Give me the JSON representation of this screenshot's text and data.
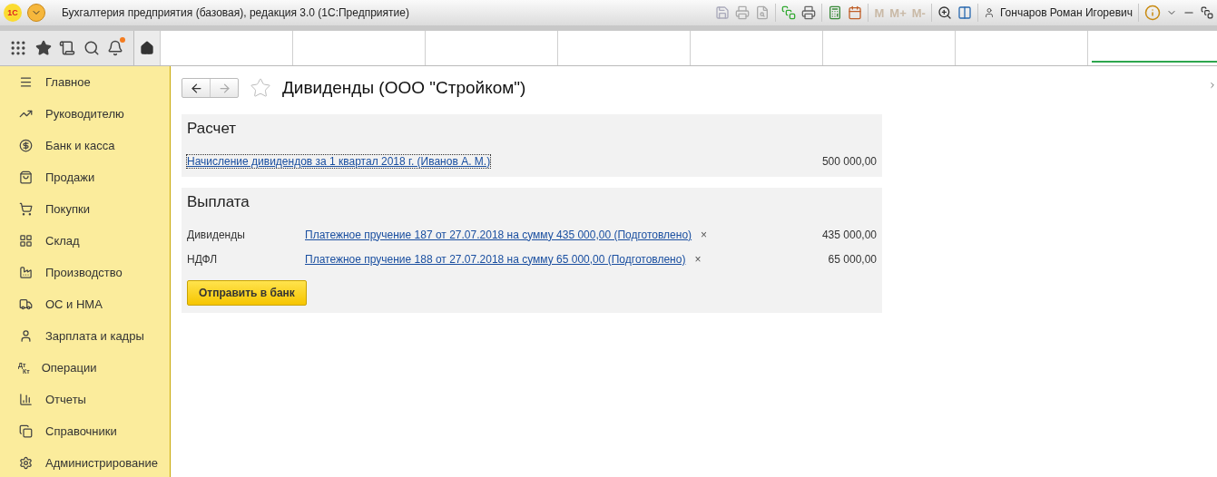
{
  "window": {
    "title": "Бухгалтерия предприятия (базовая), редакция 3.0  (1С:Предприятие)",
    "user": "Гончаров Роман Игоревич",
    "logo": "1С"
  },
  "toolbar": {
    "memory_buttons": [
      "M",
      "M+",
      "M-"
    ]
  },
  "sidebar": {
    "items": [
      {
        "label": "Главное"
      },
      {
        "label": "Руководителю"
      },
      {
        "label": "Банк и касса"
      },
      {
        "label": "Продажи"
      },
      {
        "label": "Покупки"
      },
      {
        "label": "Склад"
      },
      {
        "label": "Производство"
      },
      {
        "label": "ОС и НМА"
      },
      {
        "label": "Зарплата и кадры"
      },
      {
        "label": "Операции",
        "icon_text": [
          "Дт",
          "Кт"
        ]
      },
      {
        "label": "Отчеты"
      },
      {
        "label": "Справочники"
      },
      {
        "label": "Администрирование"
      }
    ]
  },
  "form": {
    "title": "Дивиденды (ООО \"Стройком\")",
    "sections": [
      {
        "title": "Расчет",
        "rows": [
          {
            "link": "Начисление дивидендов за 1 квартал 2018 г. (Иванов А. М.)",
            "amount": "500 000,00",
            "focused": true
          }
        ]
      },
      {
        "title": "Выплата",
        "rows": [
          {
            "label": "Дивиденды",
            "link": "Платежное пручение 187 от 27.07.2018 на сумму 435 000,00 (Подготовлено)",
            "clear": "×",
            "amount": "435 000,00",
            "focused": false
          },
          {
            "label": "НДФЛ",
            "link": "Платежное пручение 188 от 27.07.2018 на сумму 65 000,00 (Подготовлено)",
            "clear": "×",
            "amount": "65 000,00",
            "focused": false
          }
        ],
        "button": "Отправить в банк"
      }
    ]
  }
}
